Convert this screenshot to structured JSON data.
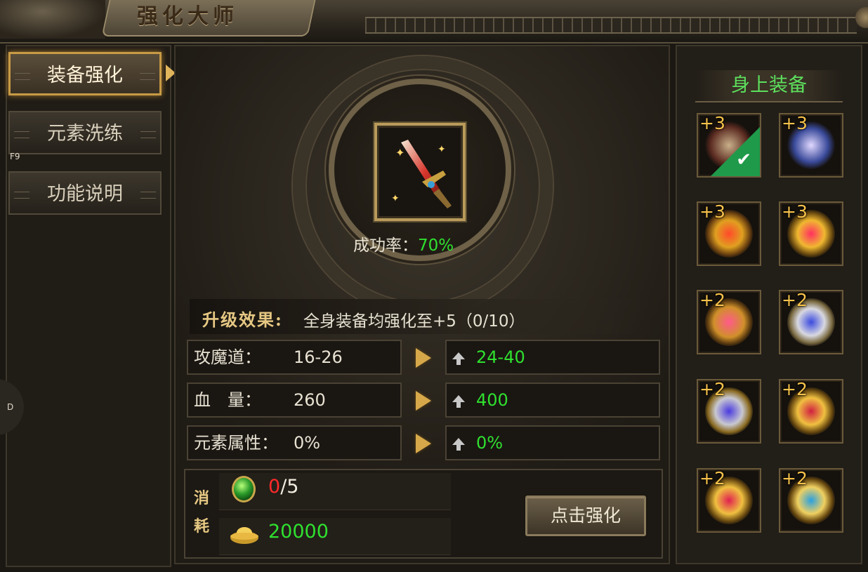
{
  "window": {
    "title": "强化大师"
  },
  "sidebar": {
    "items": [
      {
        "label": "装备强化",
        "active": true
      },
      {
        "label": "元素洗练",
        "active": false
      },
      {
        "label": "功能说明",
        "active": false
      }
    ],
    "hotkey_f9": "F9",
    "hotkey_d": "D"
  },
  "main": {
    "success_rate_label": "成功率：",
    "success_rate_value": "70%",
    "upgrade_effect_label": "升级效果:",
    "upgrade_effect_text": "全身装备均强化至+5（0/10）",
    "stats": [
      {
        "name": "攻魔道：",
        "current": "16-26",
        "next": "24-40"
      },
      {
        "name": "血　量：",
        "current": "260",
        "next": "400"
      },
      {
        "name": "元素属性：",
        "current": "0%",
        "next": "0%"
      }
    ],
    "consume": {
      "title_1": "消",
      "title_2": "耗",
      "gem_have": "0",
      "gem_need": "/5",
      "gold": "20000"
    },
    "enhance_button": "点击强化"
  },
  "equipment": {
    "header": "身上装备",
    "slots": [
      {
        "level": "+3",
        "icon": "weapon-sword-icon",
        "selected": true
      },
      {
        "level": "+3",
        "icon": "armor-icon",
        "selected": false
      },
      {
        "level": "+3",
        "icon": "necklace-icon",
        "selected": false
      },
      {
        "level": "+3",
        "icon": "helmet-icon",
        "selected": false
      },
      {
        "level": "+2",
        "icon": "bracelet-icon",
        "selected": false
      },
      {
        "level": "+2",
        "icon": "ring-icon",
        "selected": false
      },
      {
        "level": "+2",
        "icon": "ring-icon",
        "selected": false
      },
      {
        "level": "+2",
        "icon": "bracelet-icon",
        "selected": false
      },
      {
        "level": "+2",
        "icon": "belt-icon",
        "selected": false
      },
      {
        "level": "+2",
        "icon": "boots-icon",
        "selected": false
      }
    ]
  },
  "colors": {
    "success_green": "#2fe02f",
    "gold_text": "#f6c24a",
    "insufficient_red": "#ff2a2a",
    "frame_gold": "#c89a45"
  }
}
